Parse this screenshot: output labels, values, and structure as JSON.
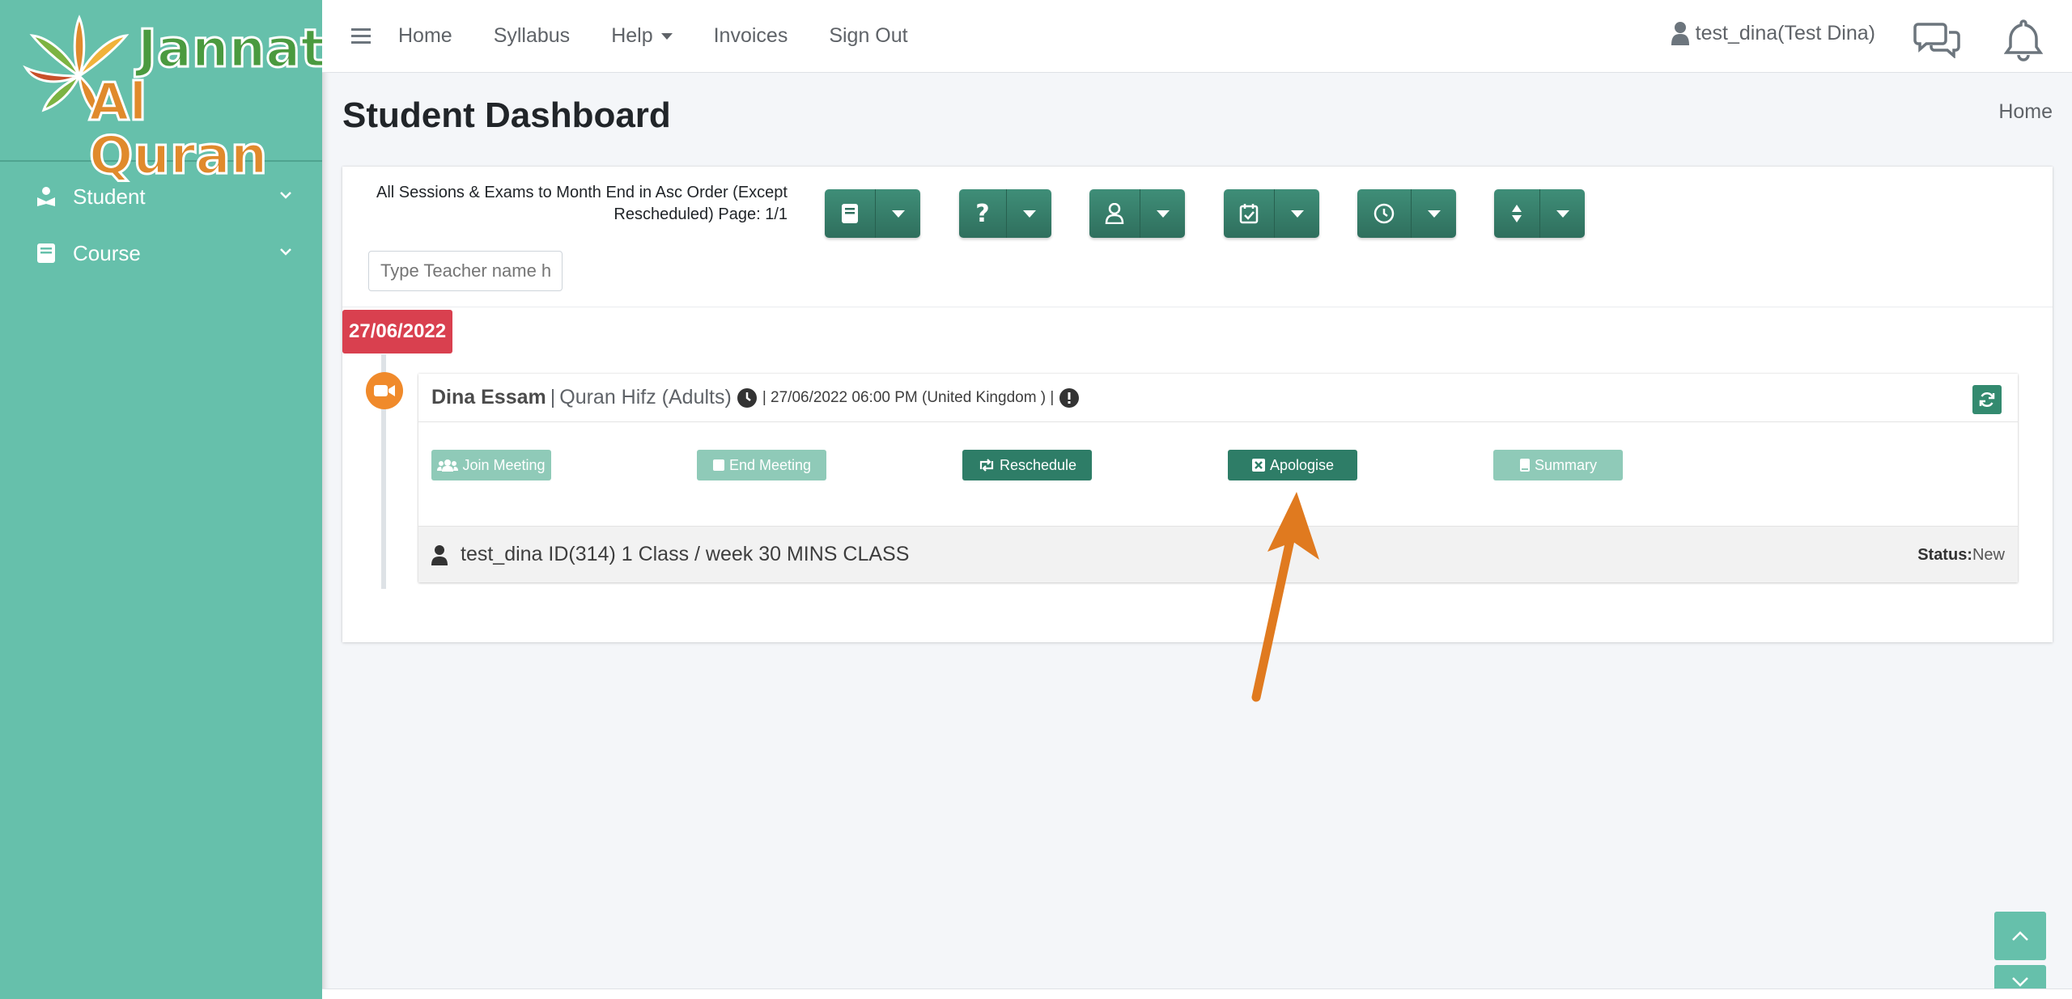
{
  "brand": {
    "line1": "Jannat",
    "line2": "Al Quran"
  },
  "sidebar": {
    "items": [
      {
        "label": "Student",
        "icon": "student-icon"
      },
      {
        "label": "Course",
        "icon": "book-icon"
      }
    ]
  },
  "topbar": {
    "nav": [
      "Home",
      "Syllabus",
      "Help",
      "Invoices",
      "Sign Out"
    ],
    "user": "test_dina(Test Dina)"
  },
  "page": {
    "title": "Student Dashboard",
    "breadcrumb": "Home"
  },
  "filters": {
    "caption_line1": "All Sessions & Exams to Month End in Asc Order (Except",
    "caption_line2": "Rescheduled) Page: 1/1",
    "search_placeholder": "Type Teacher name here",
    "groups": [
      "book-icon",
      "question-icon",
      "user-icon",
      "calendar-check-icon",
      "clock-icon",
      "sort-icon"
    ]
  },
  "timeline": {
    "date": "27/06/2022",
    "item": {
      "teacher": "Dina Essam",
      "course": "Quran Hifz (Adults)",
      "datetime": "27/06/2022 06:00 PM (United Kingdom )",
      "actions": {
        "join": "Join Meeting",
        "end": "End Meeting",
        "reschedule": "Reschedule",
        "apologise": "Apologise",
        "summary": "Summary"
      },
      "student_info": "test_dina ID(314) 1 Class / week 30 MINS CLASS",
      "status_label": "Status:",
      "status_value": "New"
    }
  },
  "colors": {
    "sidebar": "#66c0ab",
    "button": "#2e7d67",
    "date_badge": "#d9404f",
    "arrow": "#e07a1f"
  }
}
